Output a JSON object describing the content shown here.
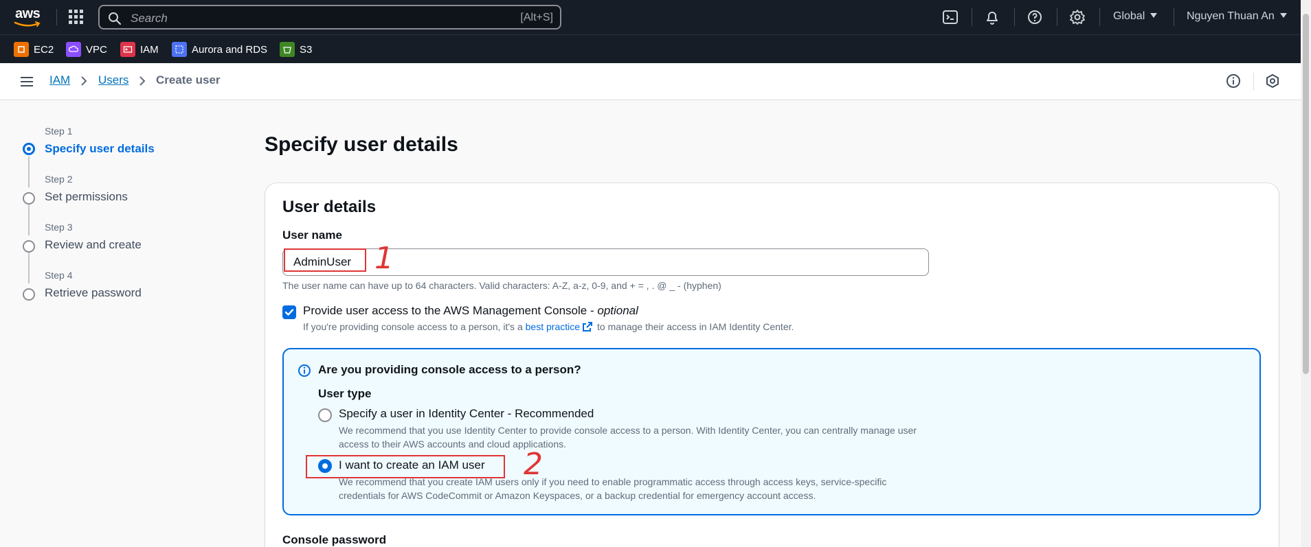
{
  "topnav": {
    "logo_text": "aws",
    "search_placeholder": "Search",
    "search_shortcut": "[Alt+S]",
    "region": "Global",
    "account": "Nguyen Thuan An",
    "icons": [
      "grid-icon",
      "search-icon",
      "cloudshell-icon",
      "bell-icon",
      "help-icon",
      "settings-icon"
    ]
  },
  "favorites": [
    {
      "label": "EC2",
      "color": "#ed7100"
    },
    {
      "label": "VPC",
      "color": "#8c4fff"
    },
    {
      "label": "IAM",
      "color": "#dd344c"
    },
    {
      "label": "Aurora and RDS",
      "color": "#4d72f3"
    },
    {
      "label": "S3",
      "color": "#3f8624"
    }
  ],
  "breadcrumb": {
    "items": [
      "IAM",
      "Users"
    ],
    "current": "Create user"
  },
  "wizard": {
    "steps": [
      {
        "label": "Step 1",
        "title": "Specify user details",
        "active": true
      },
      {
        "label": "Step 2",
        "title": "Set permissions",
        "active": false
      },
      {
        "label": "Step 3",
        "title": "Review and create",
        "active": false
      },
      {
        "label": "Step 4",
        "title": "Retrieve password",
        "active": false
      }
    ]
  },
  "main": {
    "title": "Specify user details",
    "card_title": "User details",
    "username_label": "User name",
    "username_value": "AdminUser",
    "username_hint": "The user name can have up to 64 characters. Valid characters: A-Z, a-z, 0-9, and + = , . @ _ - (hyphen)",
    "console_access_label": "Provide user access to the AWS Management Console - ",
    "console_access_optional": "optional",
    "console_access_checked": true,
    "console_desc_before": "If you're providing console access to a person, it's a ",
    "console_desc_link": "best practice",
    "console_desc_after": "to manage their access in IAM Identity Center.",
    "info_title": "Are you providing console access to a person?",
    "user_type_label": "User type",
    "options": [
      {
        "label": "Specify a user in Identity Center - Recommended",
        "desc": "We recommend that you use Identity Center to provide console access to a person. With Identity Center, you can centrally manage user access to their AWS accounts and cloud applications.",
        "selected": false
      },
      {
        "label": "I want to create an IAM user",
        "desc": "We recommend that you create IAM users only if you need to enable programmatic access through access keys, service-specific credentials for AWS CodeCommit or Amazon Keyspaces, or a backup credential for emergency account access.",
        "selected": true
      }
    ],
    "console_password_label": "Console password"
  },
  "annotations": [
    "1",
    "2"
  ],
  "colors": {
    "nav_bg": "#161d26",
    "accent": "#006ce0",
    "link": "#0073bb",
    "annotation": "#e03535",
    "info_bg": "#f0fbff"
  }
}
